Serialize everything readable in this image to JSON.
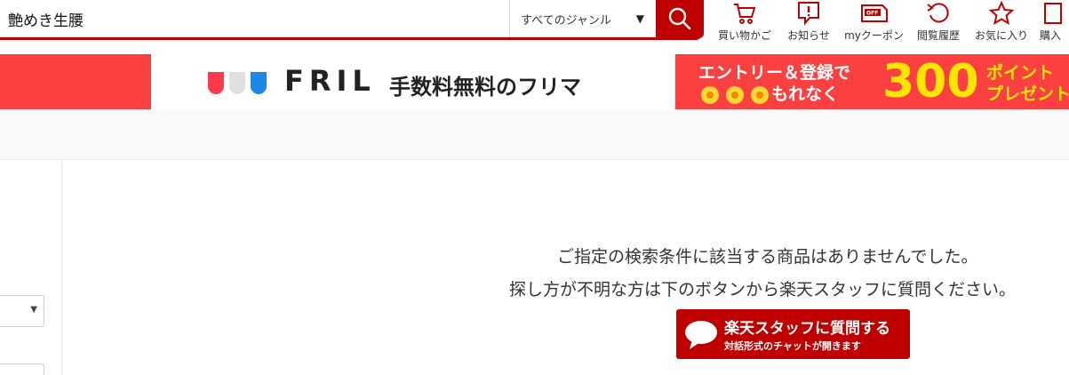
{
  "search": {
    "query": "艶めき生腰",
    "genre_selected": "すべてのジャンル"
  },
  "header_nav": [
    {
      "label": "買い物かご",
      "icon": "cart-icon"
    },
    {
      "label": "お知らせ",
      "icon": "notice-icon"
    },
    {
      "label": "myクーポン",
      "icon": "coupon-icon"
    },
    {
      "label": "閲覧履歴",
      "icon": "history-icon"
    },
    {
      "label": "お気に入り",
      "icon": "star-icon"
    },
    {
      "label": "購入",
      "icon": "purchase-icon"
    }
  ],
  "banner": {
    "logo_text": "FRIL",
    "tagline": "手数料無料のフリマ",
    "promo_line1": "エントリー＆登録で",
    "promo_line2": "もれなく",
    "promo_points": "300",
    "promo_pt_line1": "ポイント",
    "promo_pt_line2": "プレゼント"
  },
  "main": {
    "no_result_message": "ご指定の検索条件に該当する商品はありませんでした。",
    "help_message": "探し方が不明な方は下のボタンから楽天スタッフに質問ください。",
    "chat_button_title": "楽天スタッフに質問する",
    "chat_button_sub": "対話形式のチャットが開きます"
  },
  "colors": {
    "brand_red": "#bf0000",
    "banner_red": "#fb4041",
    "promo_yellow": "#ffe500"
  }
}
